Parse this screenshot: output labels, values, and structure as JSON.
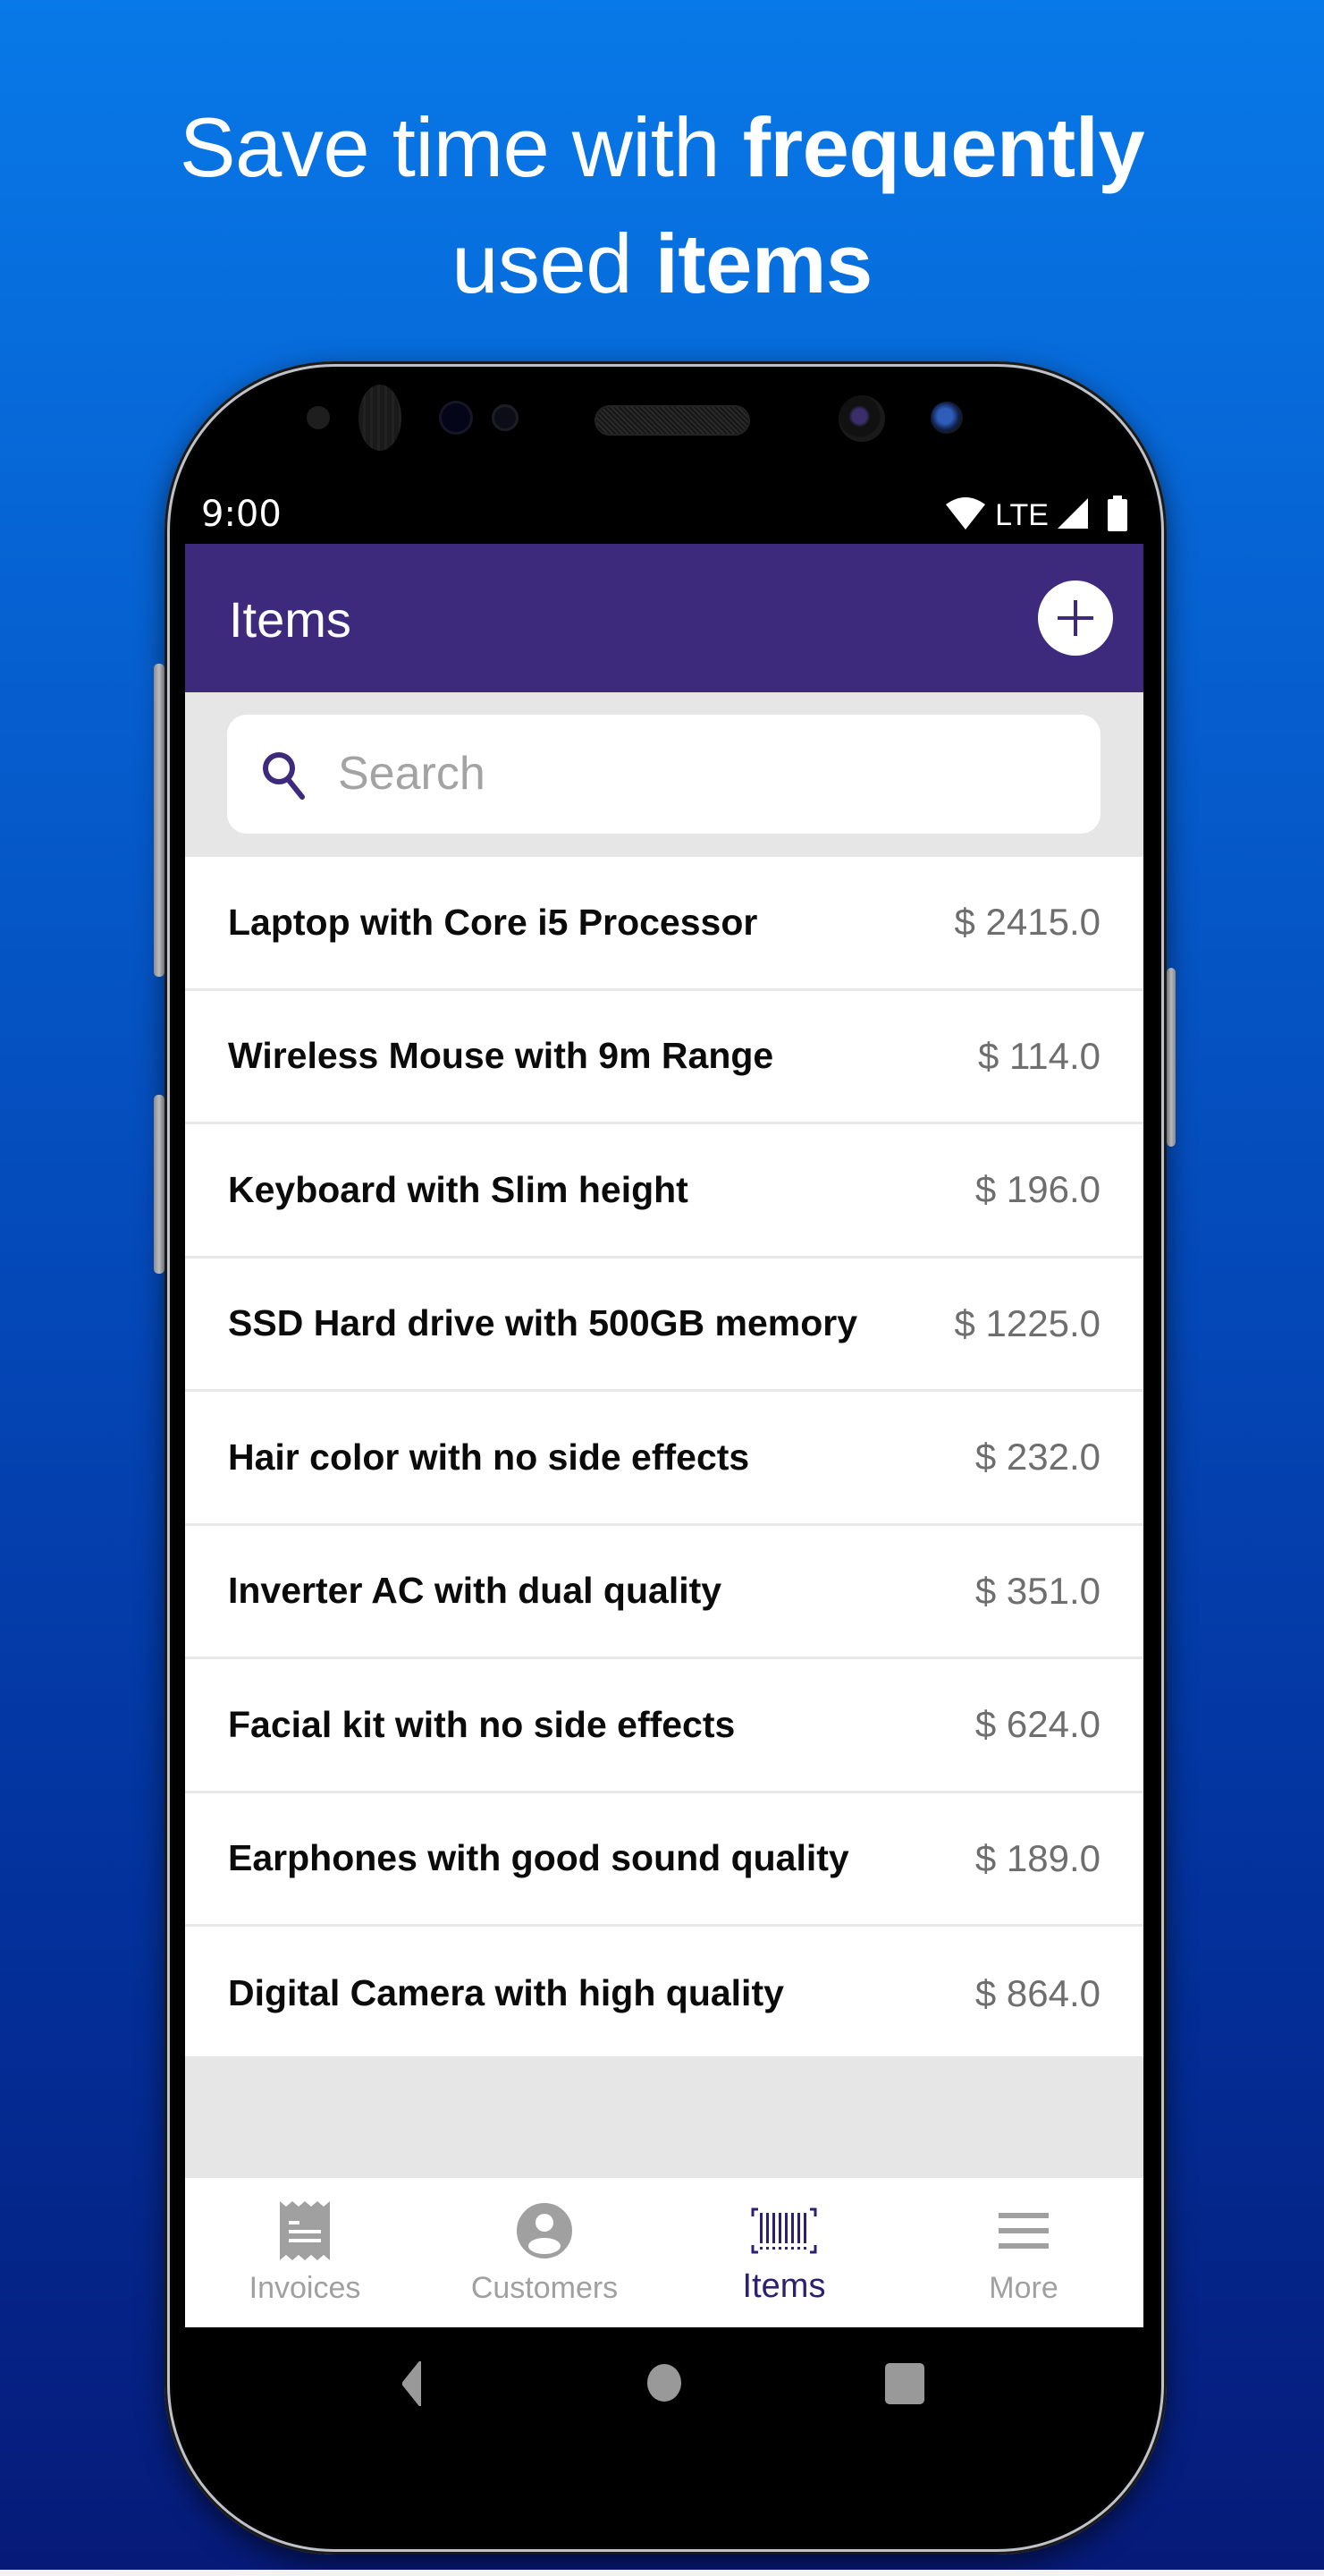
{
  "headline": {
    "line1_regular": "Save time with ",
    "line1_bold": "frequently",
    "line2_regular": "used ",
    "line2_bold": "items"
  },
  "status_bar": {
    "time": "9:00",
    "network": "LTE",
    "icons": [
      "wifi-icon",
      "signal-icon",
      "battery-icon"
    ]
  },
  "app_bar": {
    "title": "Items",
    "add_button_icon": "plus-icon"
  },
  "search": {
    "placeholder": "Search",
    "value": "",
    "icon": "search-icon"
  },
  "items": [
    {
      "name": "Laptop with Core i5 Processor",
      "price": "$ 2415.0"
    },
    {
      "name": "Wireless Mouse with 9m Range",
      "price": "$ 114.0"
    },
    {
      "name": "Keyboard with Slim height",
      "price": "$ 196.0"
    },
    {
      "name": "SSD Hard drive with 500GB memory",
      "price": "$ 1225.0"
    },
    {
      "name": "Hair color with no side effects",
      "price": "$ 232.0"
    },
    {
      "name": "Inverter AC with dual quality",
      "price": "$ 351.0"
    },
    {
      "name": "Facial kit with no side effects",
      "price": "$ 624.0"
    },
    {
      "name": "Earphones with good sound quality",
      "price": "$ 189.0"
    },
    {
      "name": "Digital Camera with high quality",
      "price": "$ 864.0"
    }
  ],
  "tabs": [
    {
      "label": "Invoices",
      "icon": "receipt-icon",
      "active": false
    },
    {
      "label": "Customers",
      "icon": "account-circle-icon",
      "active": false
    },
    {
      "label": "Items",
      "icon": "barcode-icon",
      "active": true
    },
    {
      "label": "More",
      "icon": "menu-icon",
      "active": false
    }
  ],
  "system_nav": {
    "buttons": [
      "back-icon",
      "home-icon",
      "recents-icon"
    ]
  },
  "colors": {
    "primary": "#3d2a7c",
    "active_tab": "#2d2070",
    "inactive_tab": "#a0a0a0",
    "price_text": "#6e6e6e",
    "background_top": "#0879e8",
    "background_bottom": "#061a78"
  }
}
